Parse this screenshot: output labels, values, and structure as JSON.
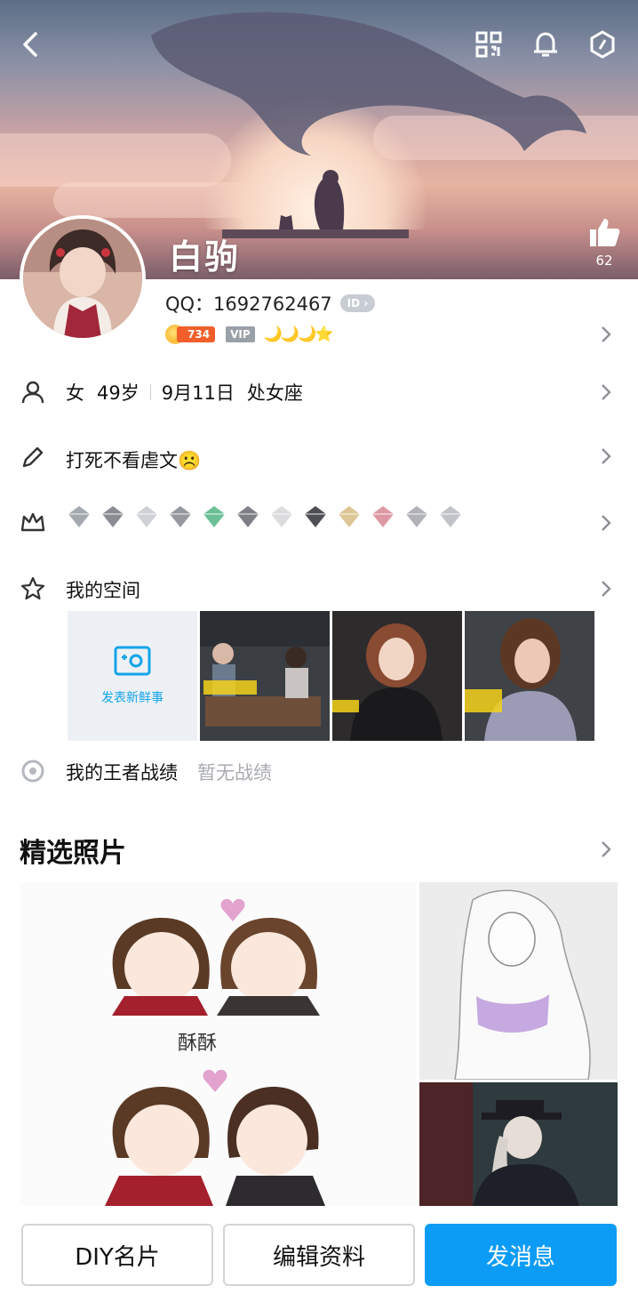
{
  "header": {
    "nickname": "白驹",
    "like_count": "62",
    "icons": [
      "back-icon",
      "qr-code-icon",
      "bell-icon",
      "hexagon-settings-icon",
      "thumbs-up-icon"
    ]
  },
  "profile": {
    "qq_line": "QQ：1692762467",
    "id_badge": "ID",
    "level": "734",
    "vip": "VIP",
    "moons": "🌙🌙🌙⭐"
  },
  "info": {
    "gender": "女",
    "age": "49岁",
    "birthday": "9月11日",
    "zodiac": "处女座",
    "signature": "打死不看虐文☹️"
  },
  "honors": {
    "colors": [
      "#9a9ea6",
      "#7d8088",
      "#c9ccd2",
      "#8a8d95",
      "#5bb98a",
      "#6e7178",
      "#d8d8dc",
      "#3a3c42",
      "#d9c089",
      "#d98e99",
      "#a7aab0",
      "#b9bcc2"
    ]
  },
  "space": {
    "title": "我的空间",
    "post_label": "发表新鲜事"
  },
  "kog": {
    "title": "我的王者战绩",
    "status": "暂无战绩"
  },
  "photos": {
    "title": "精选照片",
    "sticker_caption": "酥酥"
  },
  "actions": {
    "diy": "DIY名片",
    "edit": "编辑资料",
    "message": "发消息"
  },
  "colors": {
    "accent": "#0d9cf5",
    "level_badge": "#f25f2b",
    "muted": "#a8abb0"
  }
}
